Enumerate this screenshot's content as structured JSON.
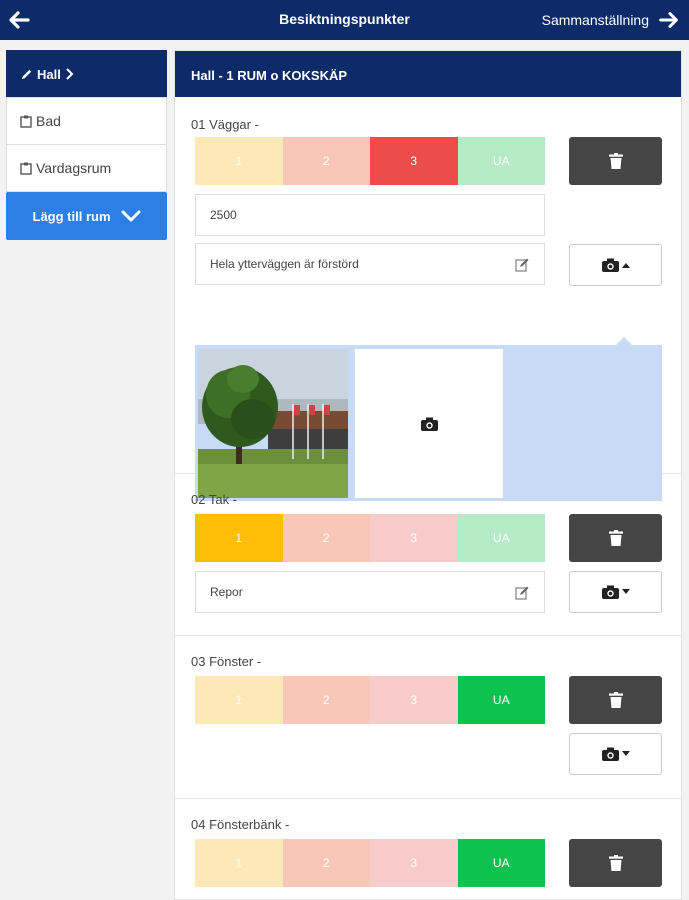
{
  "header": {
    "back_icon": "arrow-left-icon",
    "title": "Besiktningspunkter",
    "summary_label": "Sammanställning",
    "summary_icon": "arrow-right-icon"
  },
  "sidebar": {
    "items": [
      {
        "label": "Hall",
        "icon": "pencil-icon",
        "trailing": "chevron-right-icon",
        "active": true
      },
      {
        "label": "Bad",
        "icon": "clipboard-icon"
      },
      {
        "label": "Vardagsrum",
        "icon": "clipboard-icon"
      }
    ],
    "add_label": "Lägg till rum",
    "add_icon": "chevron-down-icon"
  },
  "main": {
    "title": "Hall - 1 RUM o KOKSKÄP",
    "grade_labels": [
      "1",
      "2",
      "3",
      "UA"
    ],
    "points": [
      {
        "title": "01 Väggar -",
        "selected": "3",
        "value": "2500",
        "comment": "Hela ytterväggen är förstörd",
        "gallery_open": true,
        "photos": 1
      },
      {
        "title": "02 Tak -",
        "selected": "1",
        "comment": "Repor"
      },
      {
        "title": "03 Fönster -",
        "selected": "UA"
      },
      {
        "title": "04 Fönsterbänk -",
        "selected": "UA"
      }
    ]
  },
  "colors": {
    "navy": "#0d2b69",
    "blue": "#2e7fe5",
    "grade1_selected": "#ffbe06",
    "grade3_selected": "#ec4c4c",
    "ua_selected": "#0dc350",
    "dark_button": "#454545"
  }
}
